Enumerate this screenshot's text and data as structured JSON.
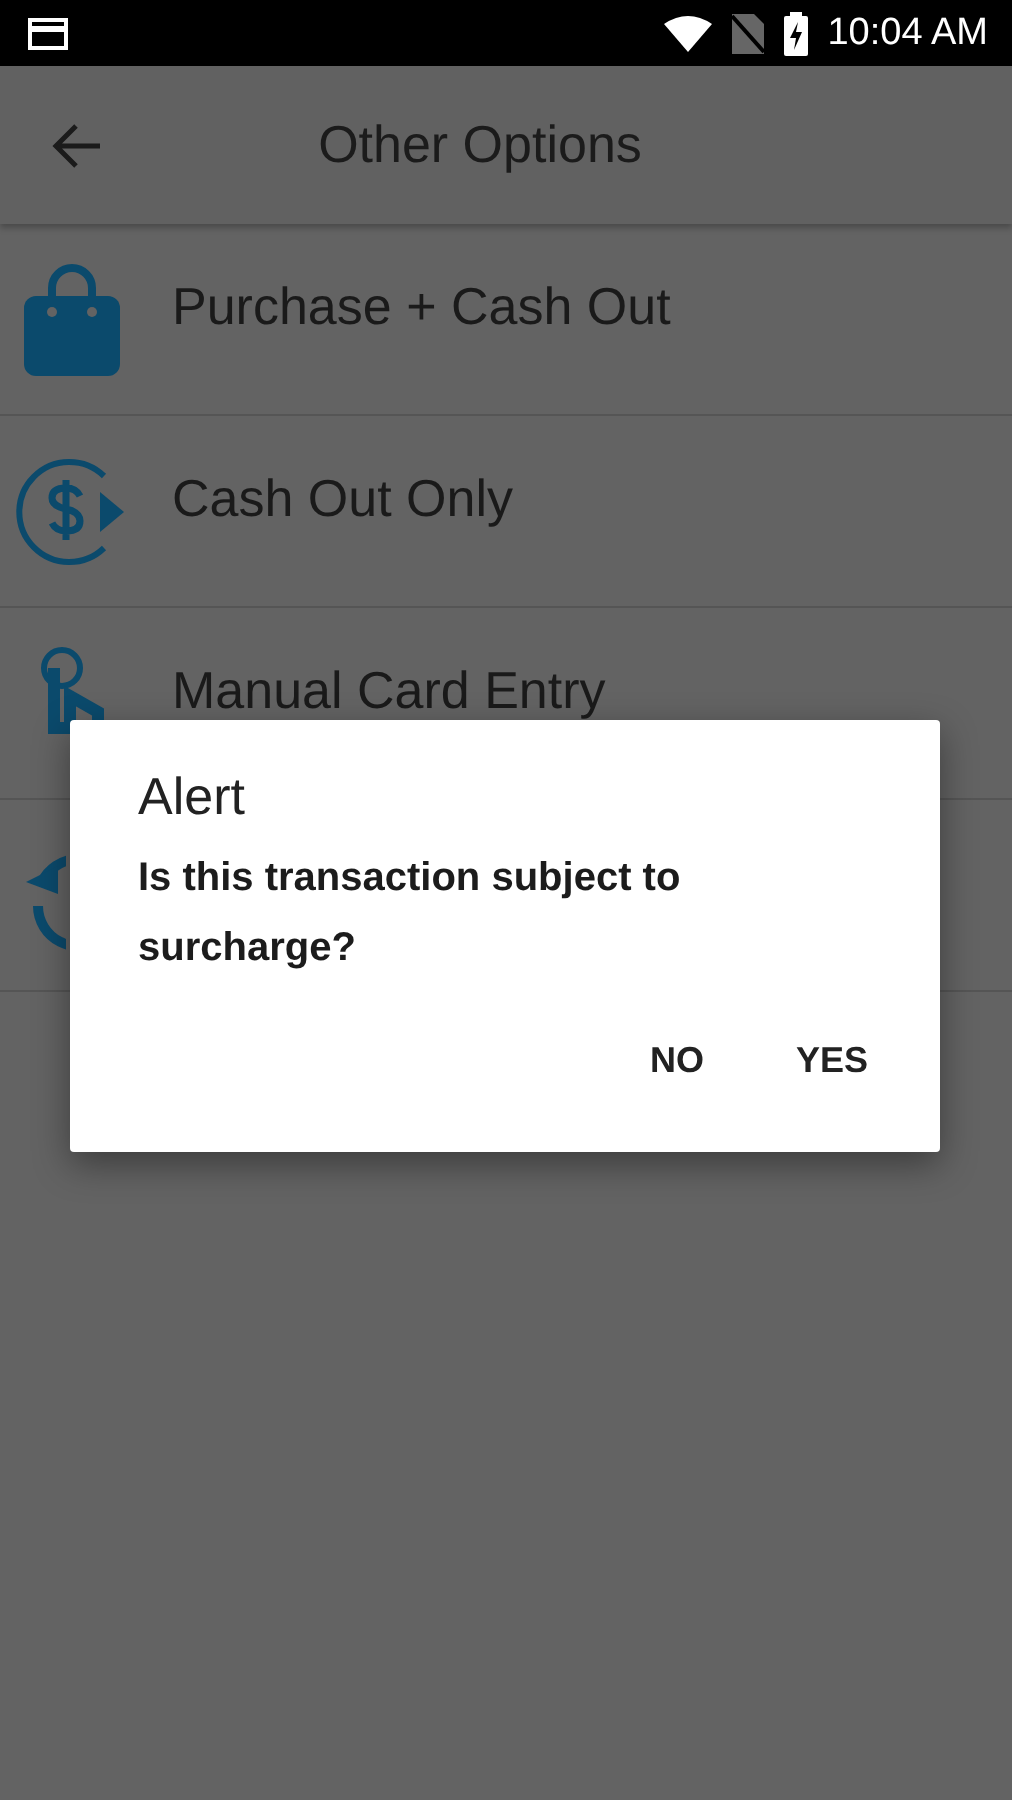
{
  "status_bar": {
    "time": "10:04 AM"
  },
  "app_bar": {
    "title": "Other Options"
  },
  "options": [
    {
      "kind": "bag",
      "label": "Purchase + Cash Out"
    },
    {
      "kind": "cash",
      "label": "Cash Out Only"
    },
    {
      "kind": "touch",
      "label": "Manual Card Entry"
    },
    {
      "kind": "refresh"
    }
  ],
  "dialog": {
    "title": "Alert",
    "message": "Is this transaction subject to surcharge?",
    "buttons": [
      "NO",
      "YES"
    ]
  }
}
